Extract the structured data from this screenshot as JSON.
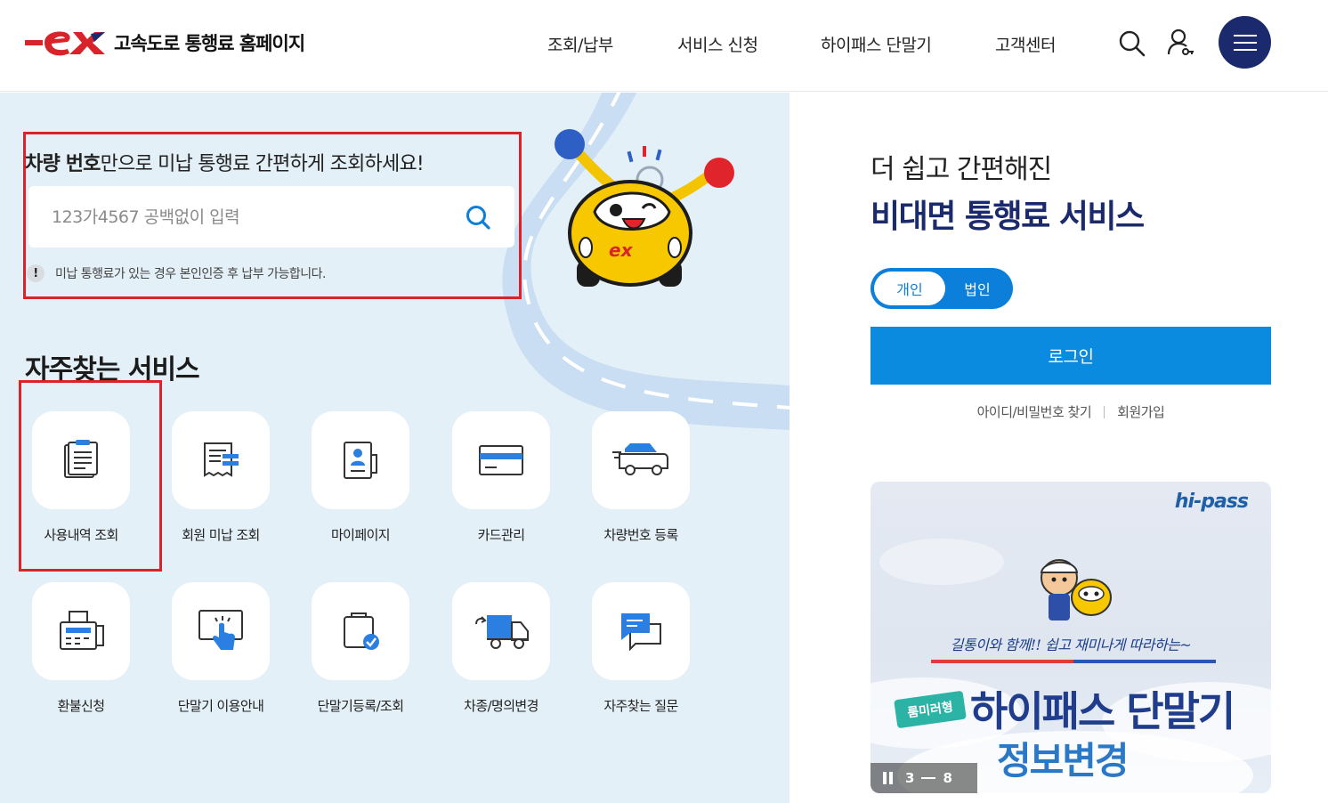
{
  "header": {
    "logo_text": "고속도로 통행료 홈페이지",
    "nav": [
      {
        "label": "조회/납부"
      },
      {
        "label": "서비스 신청"
      },
      {
        "label": "하이패스 단말기"
      },
      {
        "label": "고객센터"
      }
    ],
    "icons": {
      "search": "search-icon",
      "user": "user-icon",
      "menu": "hamburger-menu-icon"
    },
    "menu_color": "#1a2a6c"
  },
  "search": {
    "title_bold": "차량 번호",
    "title_rest": "만으로 미납 통행료 간편하게 조회하세요!",
    "placeholder": "123가4567 공백없이 입력",
    "notice_mark": "!",
    "notice": "미납 통행료가 있는 경우 본인인증 후 납부 가능합니다."
  },
  "frequent": {
    "title": "자주찾는 서비스",
    "items": [
      {
        "label": "사용내역 조회",
        "icon": "usage-history-icon"
      },
      {
        "label": "회원 미납 조회",
        "icon": "receipt-icon"
      },
      {
        "label": "마이페이지",
        "icon": "profile-card-icon"
      },
      {
        "label": "카드관리",
        "icon": "credit-card-icon"
      },
      {
        "label": "차량번호 등록",
        "icon": "car-register-icon"
      },
      {
        "label": "환불신청",
        "icon": "fax-refund-icon"
      },
      {
        "label": "단말기 이용안내",
        "icon": "touch-screen-icon"
      },
      {
        "label": "단말기등록/조회",
        "icon": "device-check-icon"
      },
      {
        "label": "차종/명의변경",
        "icon": "truck-change-icon"
      },
      {
        "label": "자주찾는 질문",
        "icon": "faq-chat-icon"
      }
    ]
  },
  "account": {
    "subtitle": "더 쉽고 간편해진",
    "title": "비대면 통행료 서비스",
    "toggle_personal": "개인",
    "toggle_corporate": "법인",
    "login": "로그인",
    "find_id": "아이디/비밀번호 찾기",
    "signup": "회원가입",
    "accent": "#0b8be0"
  },
  "banner": {
    "brand": "hi-pass",
    "caption": "길통이와 함께!! 쉽고 재미나게 따라하는~",
    "badge": "룸미러형",
    "headline": "하이패스 단말기",
    "subheadline": "정보변경",
    "current": "3",
    "total": "8"
  }
}
